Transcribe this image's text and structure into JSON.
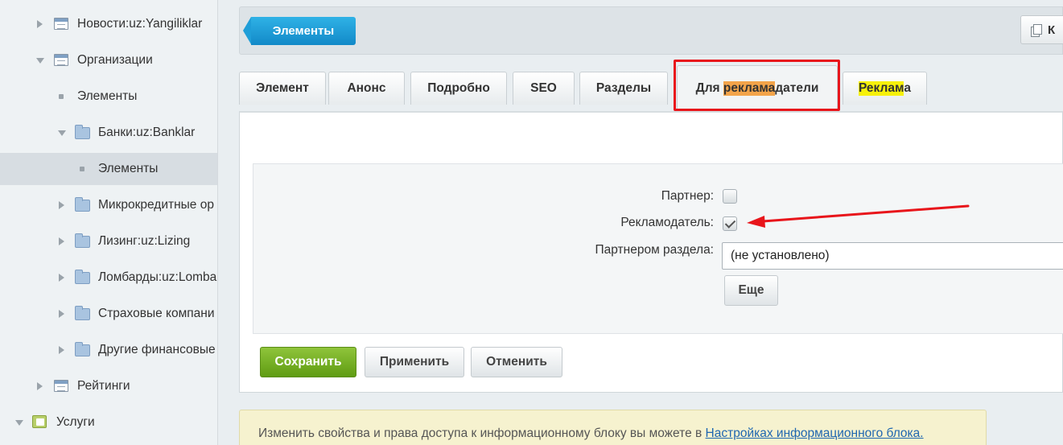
{
  "sidebar": {
    "items": [
      {
        "label": "Новости:uz:Yangiliklar"
      },
      {
        "label": "Организации"
      },
      {
        "label": "Элементы"
      },
      {
        "label": "Банки:uz:Banklar"
      },
      {
        "label": "Элементы"
      },
      {
        "label": "Микрокредитные ор"
      },
      {
        "label": "Лизинг:uz:Lizing"
      },
      {
        "label": "Ломбарды:uz:Lomba"
      },
      {
        "label": "Страховые компани"
      },
      {
        "label": "Другие финансовые"
      },
      {
        "label": "Рейтинги"
      },
      {
        "label": "Услуги"
      }
    ]
  },
  "header": {
    "elements_button": "Элементы",
    "k_button": "К"
  },
  "tabs": {
    "element": "Элемент",
    "anons": "Анонс",
    "podrobno": "Подробно",
    "seo": "SEO",
    "razdely": "Разделы",
    "advertisers_prefix": "Для ",
    "advertisers_highlight": "реклама",
    "advertisers_suffix": "датели",
    "reklama_highlight": "Реклам",
    "reklama_suffix": "а"
  },
  "form": {
    "partner_label": "Партнер:",
    "partner_checked": false,
    "advertiser_label": "Рекламодатель:",
    "advertiser_checked": true,
    "section_partner_label": "Партнером раздела:",
    "section_partner_value": "(не установлено)",
    "more_button": "Еще"
  },
  "actions": {
    "save": "Сохранить",
    "apply": "Применить",
    "cancel": "Отменить"
  },
  "notice": {
    "text": "Изменить свойства и права доступа к информационному блоку вы можете в ",
    "link": "Настройках информационного блока."
  },
  "colors": {
    "accent_blue": "#1b9bd8",
    "save_green": "#6fa61e",
    "annotation_red": "#e8151b",
    "highlight_orange": "#f3a44a",
    "highlight_yellow": "#f7f10a"
  }
}
